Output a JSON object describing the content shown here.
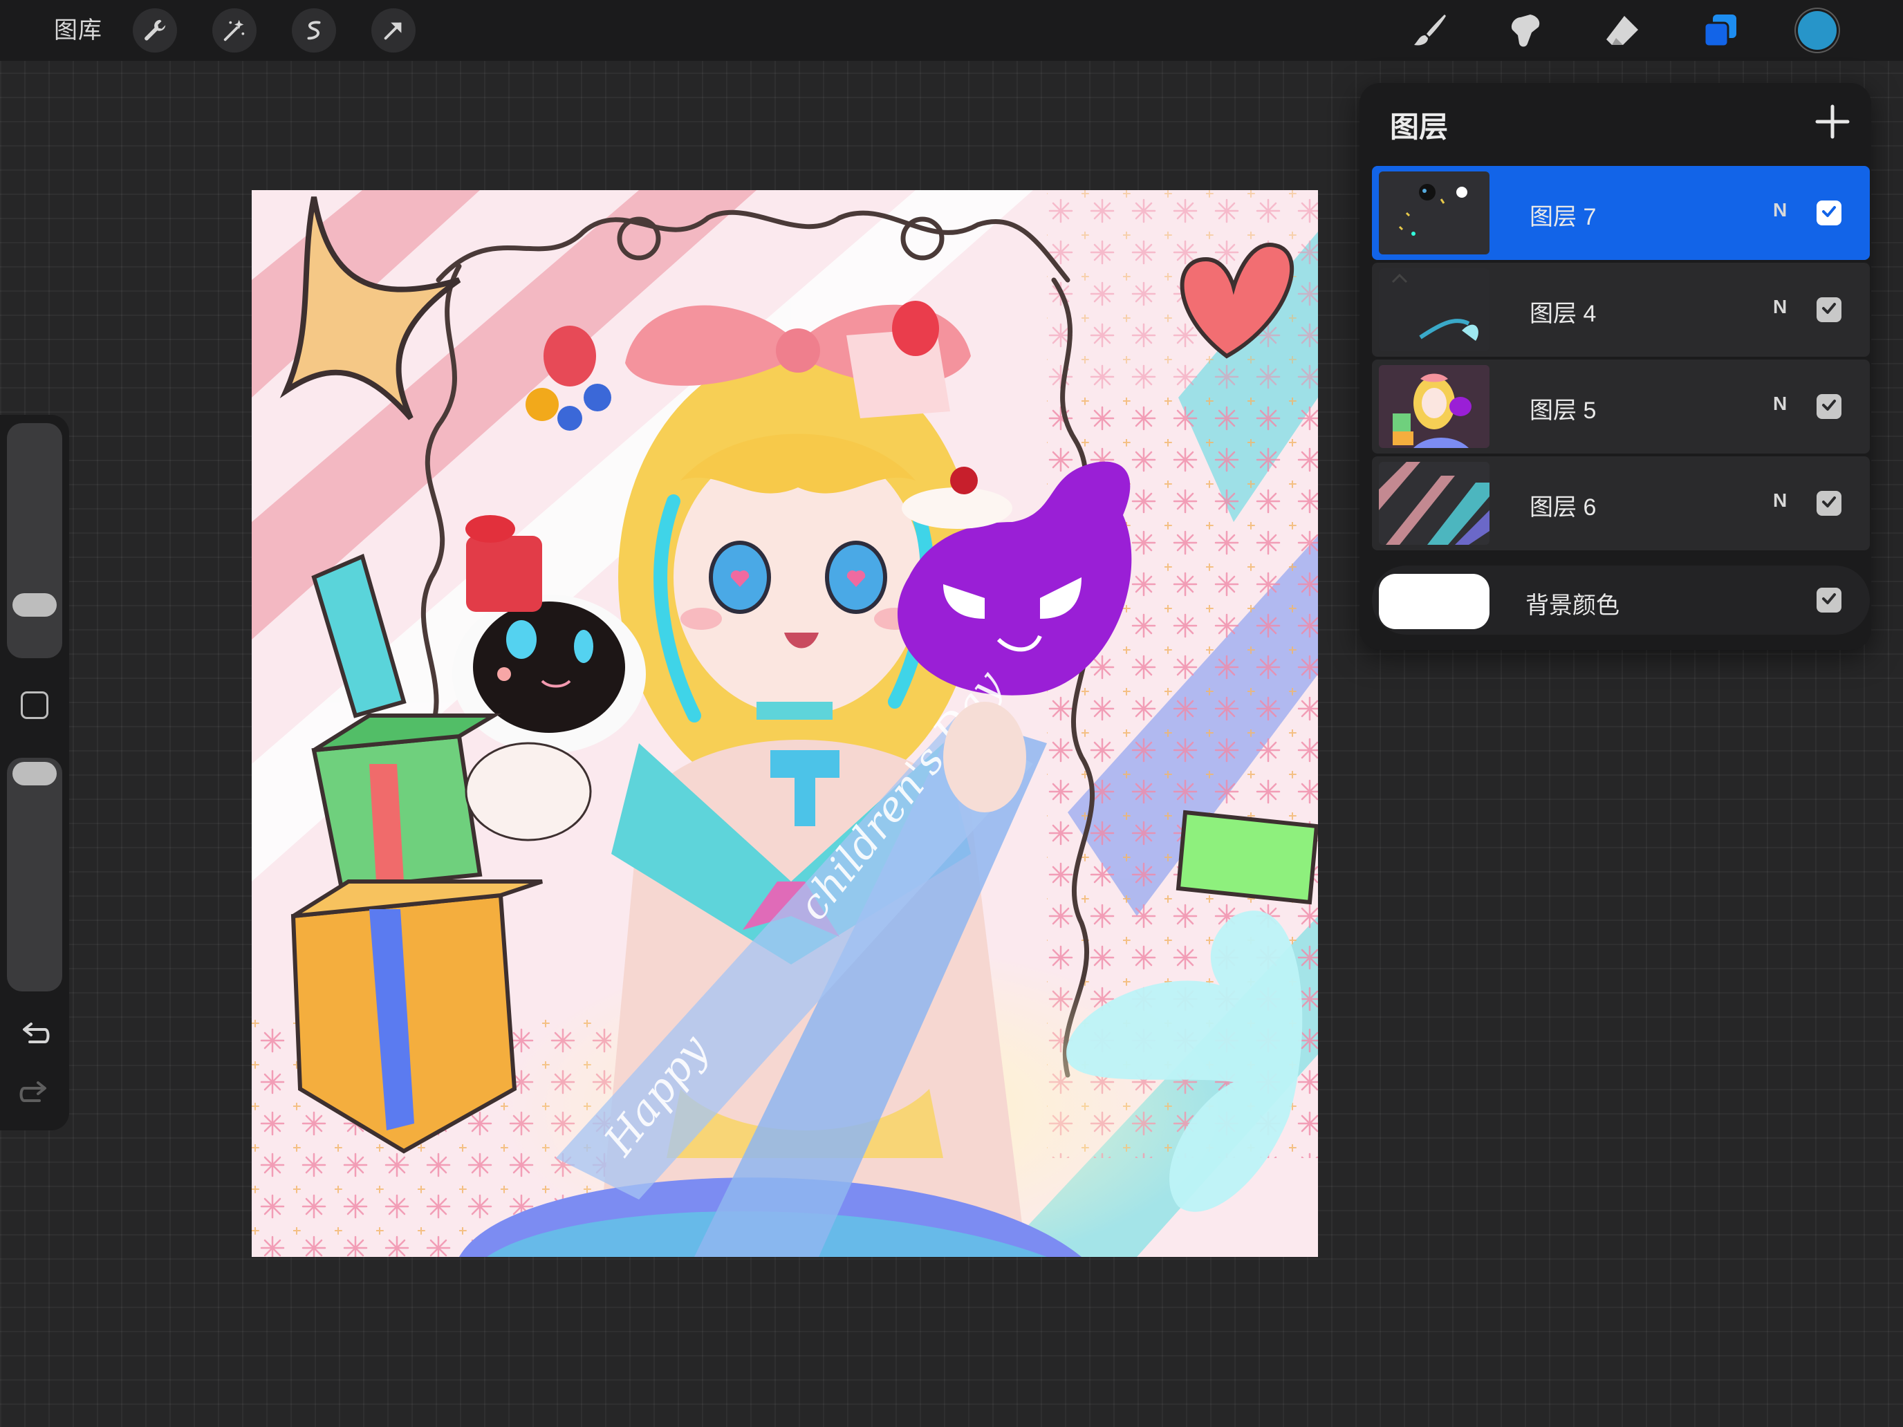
{
  "app": {
    "gallery_label": "图库"
  },
  "toolbar": {
    "left_tools": [
      "wrench-icon",
      "magic-wand-icon",
      "selection-icon",
      "transform-arrow-icon"
    ],
    "right_tools": [
      "brush-icon",
      "smudge-icon",
      "eraser-icon",
      "layers-icon"
    ],
    "active_color": "#2795c9"
  },
  "layers_panel": {
    "title": "图层",
    "layers": [
      {
        "name": "图层 7",
        "blend": "N",
        "visible": true,
        "active": true
      },
      {
        "name": "图层 4",
        "blend": "N",
        "visible": true,
        "active": false
      },
      {
        "name": "图层 5",
        "blend": "N",
        "visible": true,
        "active": false
      },
      {
        "name": "图层 6",
        "blend": "N",
        "visible": true,
        "active": false
      }
    ],
    "background": {
      "name": "背景颜色",
      "visible": true,
      "color": "#ffffff"
    }
  },
  "colors": {
    "accent": "#1264e8",
    "panel": "#1b1b1c",
    "background": "#262627"
  }
}
